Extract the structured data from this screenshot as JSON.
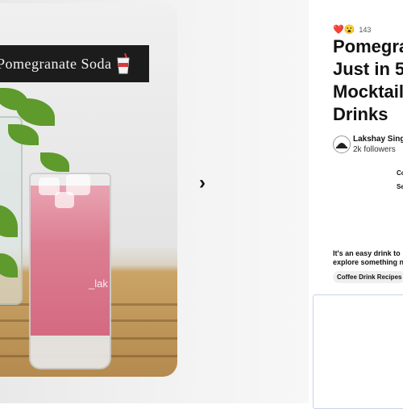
{
  "pin_image": {
    "overlay_title": "Pomegranate Soda",
    "watermark": "_lak"
  },
  "navigation": {
    "next_icon": "chevron-right-icon"
  },
  "pin_details": {
    "reaction_emojis": [
      "❤️",
      "😮"
    ],
    "reaction_count": "143",
    "title": "Pomegra\nJust in 5\nMocktail\nDrinks",
    "creator": {
      "name": "Lakshay Sing",
      "followers": "2k followers"
    },
    "side_text_1": "Co",
    "side_text_2": "Se",
    "description": "It's an easy drink to\nexplore something n",
    "tag": "Coffee Drink Recipes"
  },
  "colors": {
    "drink_pink": "#dc7d92",
    "banner_bg": "#1c1c1c",
    "comment_border": "#c9d3ea"
  }
}
